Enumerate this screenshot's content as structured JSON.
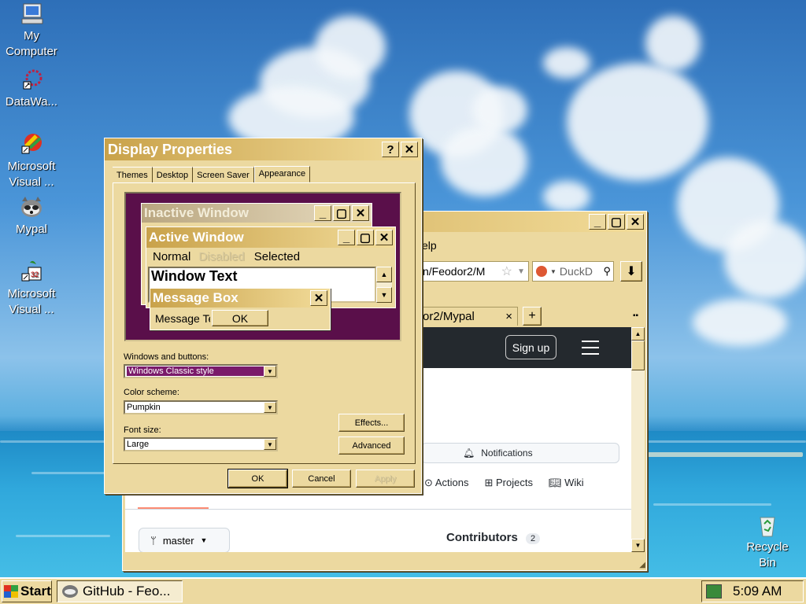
{
  "desktop_icons": [
    {
      "label_line1": "My",
      "label_line2": "Computer",
      "icon": "my-computer-icon"
    },
    {
      "label_line1": "DataWa...",
      "label_line2": "",
      "icon": "datawa-icon"
    },
    {
      "label_line1": "Microsoft",
      "label_line2": "Visual ...",
      "icon": "visual-studio-icon"
    },
    {
      "label_line1": "Mypal",
      "label_line2": "",
      "icon": "mypal-icon"
    },
    {
      "label_line1": "Microsoft",
      "label_line2": "Visual ...",
      "icon": "visual-foxpro-icon"
    },
    {
      "label_line1": "Recycle",
      "label_line2": "Bin",
      "icon": "recycle-bin-icon"
    }
  ],
  "browser": {
    "menu_fragment": "elp",
    "url_fragment": "n/Feodor2/M",
    "search_placeholder": "DuckD",
    "tab_title": "or2/Mypal",
    "tab_close": "×",
    "new_tab": "+",
    "signup": "Sign up",
    "notifications": "Notifications",
    "nav": {
      "actions": "Actions",
      "projects": "Projects",
      "wiki": "Wiki"
    },
    "branch": "master",
    "contributors_label": "Contributors",
    "contributors_count": "2"
  },
  "dialog": {
    "title": "Display Properties",
    "help": "?",
    "close": "✕",
    "tabs": [
      "Themes",
      "Desktop",
      "Screen Saver",
      "Appearance"
    ],
    "preview": {
      "inactive_title": "Inactive Window",
      "active_title": "Active Window",
      "menu_normal": "Normal",
      "menu_disabled": "Disabled",
      "menu_selected": "Selected",
      "window_text": "Window Text",
      "msgbox_title": "Message Box",
      "msgbox_text": "Message Text",
      "ok": "OK"
    },
    "windows_buttons_label": "Windows and buttons:",
    "windows_buttons_value": "Windows Classic style",
    "color_scheme_label": "Color scheme:",
    "color_scheme_value": "Pumpkin",
    "font_size_label": "Font size:",
    "font_size_value": "Large",
    "effects": "Effects...",
    "advanced": "Advanced",
    "ok": "OK",
    "cancel": "Cancel",
    "apply": "Apply"
  },
  "taskbar": {
    "start": "Start",
    "task_label": "GitHub - Feo...",
    "clock": "5:09 AM"
  },
  "colors": {
    "face": "#ecd9a0",
    "title_start": "#c9a24a",
    "title_end": "#f2dc9a",
    "preview_bg": "#5a0f4a",
    "selection": "#7a1a6a"
  }
}
